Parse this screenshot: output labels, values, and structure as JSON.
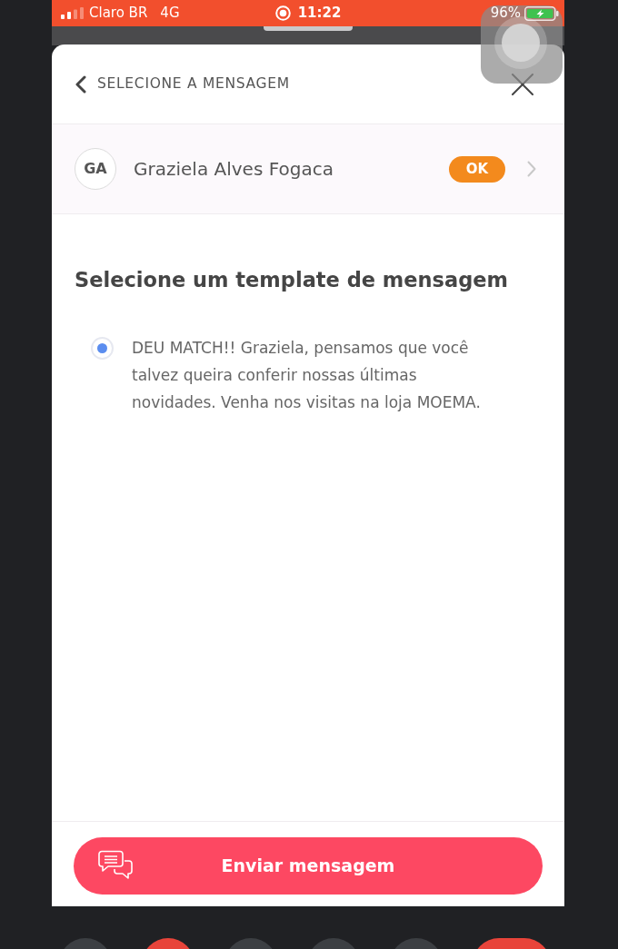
{
  "status_bar": {
    "carrier": "Claro BR",
    "network": "4G",
    "time": "11:22",
    "battery": "96%"
  },
  "header": {
    "title": "SELECIONE A MENSAGEM"
  },
  "contact": {
    "initials": "GA",
    "name": "Graziela Alves Fogaca",
    "status": "OK"
  },
  "section_title": "Selecione um template de mensagem",
  "templates": [
    {
      "text": "DEU MATCH!! Graziela, pensamos que você talvez queira conferir nossas últimas novidades. Venha nos visitas na loja MOEMA.",
      "selected": true
    }
  ],
  "send_button": {
    "label": "Enviar mensagem"
  }
}
